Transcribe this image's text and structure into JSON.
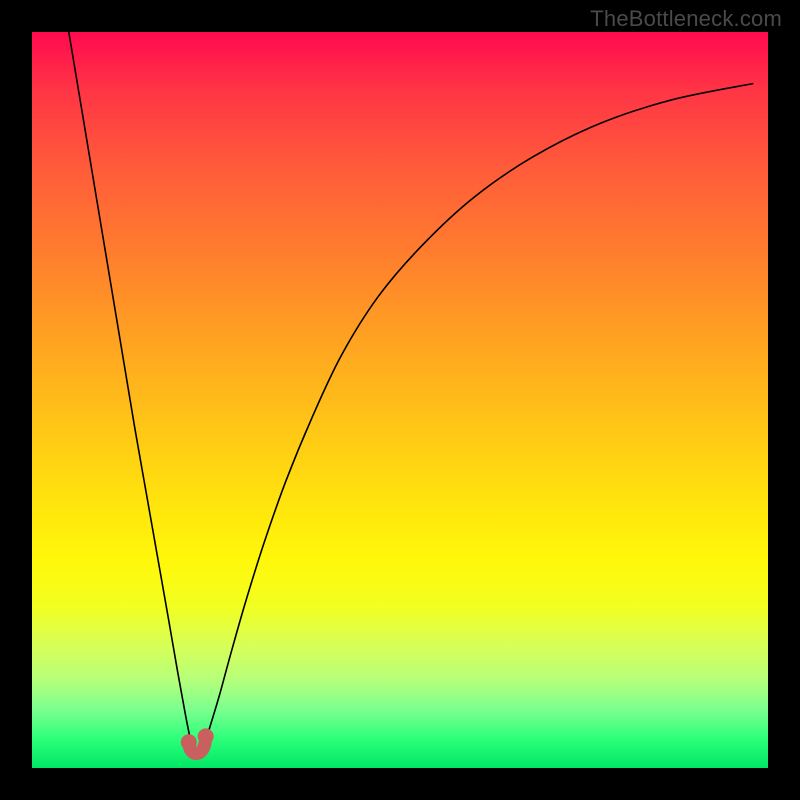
{
  "attribution": "TheBottleneck.com",
  "colors": {
    "background": "#000000",
    "curve": "#000000",
    "marker": "#c9605f",
    "gradient_top": "#ff0a4f",
    "gradient_bottom": "#00e765"
  },
  "chart_data": {
    "type": "line",
    "title": "",
    "xlabel": "",
    "ylabel": "",
    "xlim": [
      0,
      100
    ],
    "ylim": [
      0,
      100
    ],
    "x": [
      5,
      6.5,
      8,
      9.5,
      11,
      12.5,
      14,
      15.5,
      17,
      18.5,
      19.8,
      20.8,
      21.5,
      22,
      22.5,
      23,
      23.5,
      24.3,
      25.5,
      27,
      29,
      31.5,
      34.5,
      38,
      42,
      47,
      53,
      60,
      68,
      77,
      87,
      98
    ],
    "values": [
      100,
      91,
      82,
      73,
      64,
      55,
      46,
      37.5,
      29,
      20.5,
      13,
      7.5,
      4,
      2.3,
      2,
      2.2,
      3.5,
      6,
      10,
      15.5,
      22.5,
      30.5,
      39,
      47.5,
      56,
      64,
      71,
      77.5,
      83,
      87.5,
      90.8,
      93
    ],
    "annotations": [
      {
        "label": "u-marker-left",
        "x": 21.3,
        "y": 3.5
      },
      {
        "label": "u-marker-right",
        "x": 23.6,
        "y": 4.3
      }
    ]
  }
}
